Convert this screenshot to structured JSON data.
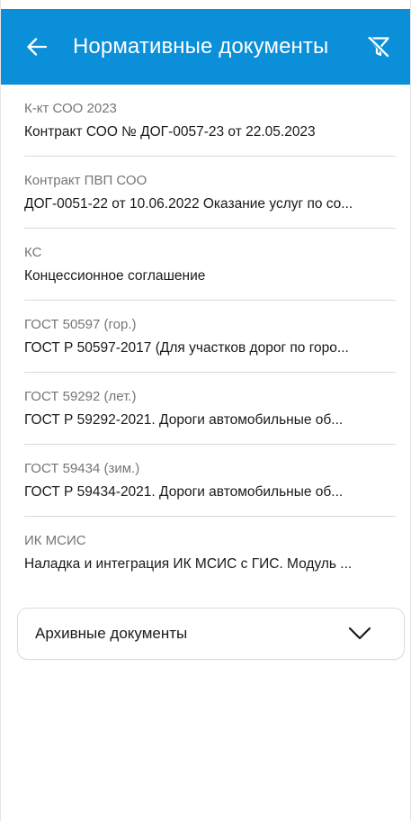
{
  "app_bar": {
    "title": "Нормативные документы",
    "back_icon": "arrow-left-icon",
    "filter_icon": "filter-off-icon",
    "background_color": "#0b8fd8"
  },
  "documents": [
    {
      "code": "К-кт СОО 2023",
      "description": "Контракт СОО № ДОГ-0057-23 от 22.05.2023"
    },
    {
      "code": "Контракт ПВП СОО",
      "description": "ДОГ-0051-22 от 10.06.2022 Оказание услуг по со..."
    },
    {
      "code": "КС",
      "description": "Концессионное соглашение"
    },
    {
      "code": "ГОСТ 50597 (гор.)",
      "description": "ГОСТ Р 50597-2017 (Для участков дорог по горо..."
    },
    {
      "code": "ГОСТ 59292 (лет.)",
      "description": "ГОСТ Р 59292-2021. Дороги автомобильные об..."
    },
    {
      "code": "ГОСТ 59434 (зим.)",
      "description": "ГОСТ Р 59434-2021. Дороги автомобильные об..."
    },
    {
      "code": "ИК МСИС",
      "description": "Наладка и интеграция ИК МСИС с ГИС. Модуль ..."
    }
  ],
  "archive": {
    "label": "Архивные документы",
    "icon": "chevron-down-icon"
  }
}
